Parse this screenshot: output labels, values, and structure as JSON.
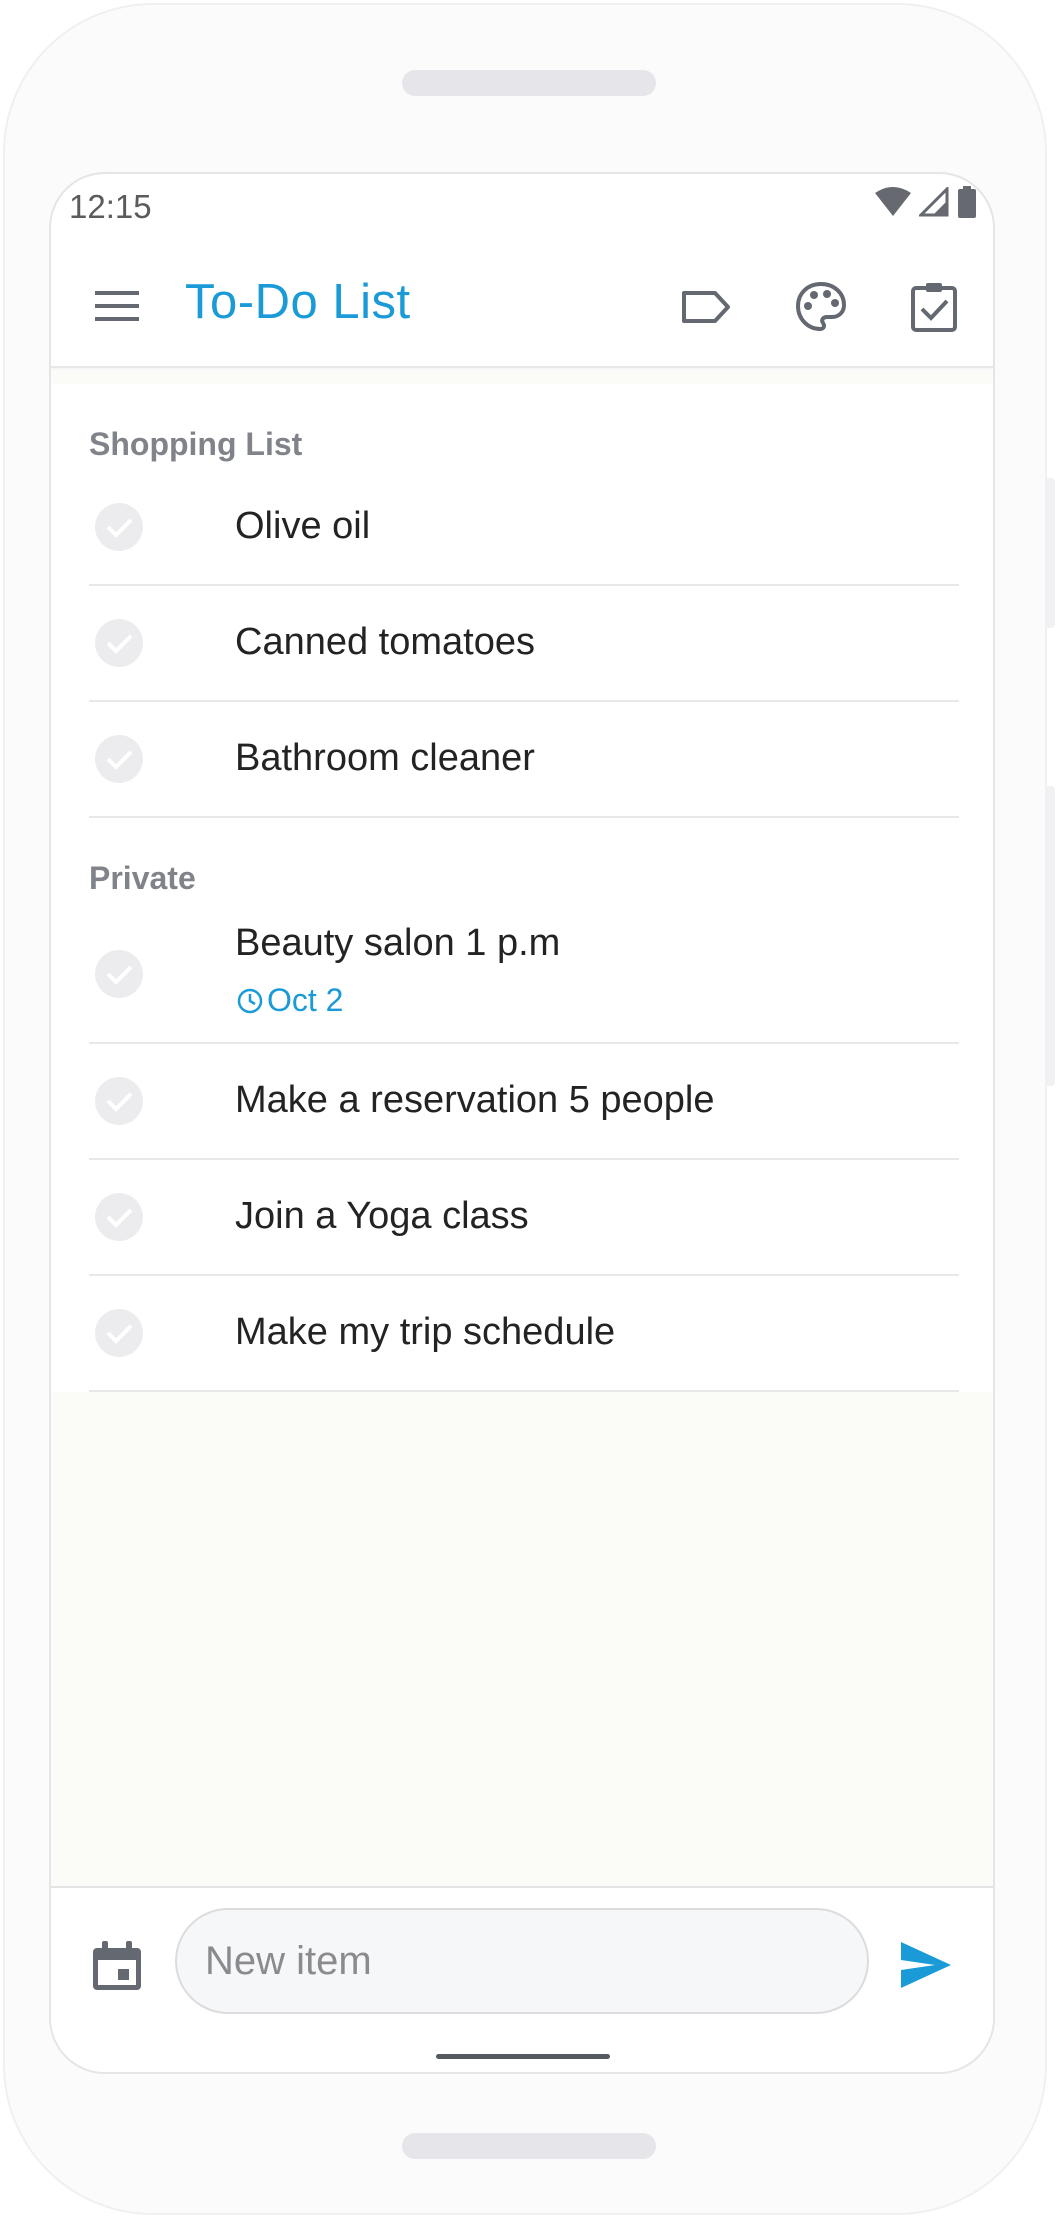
{
  "status_bar": {
    "time": "12:15",
    "icons": [
      "wifi-icon",
      "cellular-signal-icon",
      "battery-icon"
    ]
  },
  "app_bar": {
    "title": "To-Do List",
    "actions": [
      "label-icon",
      "palette-icon",
      "assignment-check-icon"
    ]
  },
  "sections": [
    {
      "title": "Shopping List",
      "items": [
        {
          "text": "Olive oil"
        },
        {
          "text": "Canned tomatoes"
        },
        {
          "text": "Bathroom cleaner"
        }
      ]
    },
    {
      "title": "Private",
      "items": [
        {
          "text": "Beauty salon 1 p.m",
          "due": "Oct 2"
        },
        {
          "text": "Make a reservation 5 people"
        },
        {
          "text": "Join a Yoga class"
        },
        {
          "text": "Make my trip schedule"
        }
      ]
    }
  ],
  "input": {
    "placeholder": "New item"
  },
  "colors": {
    "accent": "#1a9ad6",
    "section_header": "#80848a",
    "check_circle": "#ececee",
    "content_background": "#fbfbf7"
  }
}
